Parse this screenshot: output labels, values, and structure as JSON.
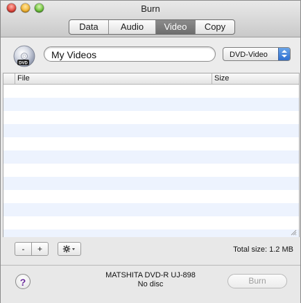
{
  "window": {
    "title": "Burn",
    "tabs": [
      {
        "label": "Data",
        "active": false
      },
      {
        "label": "Audio",
        "active": false
      },
      {
        "label": "Video",
        "active": true
      },
      {
        "label": "Copy",
        "active": false
      }
    ]
  },
  "toolbar": {
    "disc_icon": "dvd-disc-icon",
    "disc_icon_label": "DVD",
    "name_value": "My Videos",
    "format_selected": "DVD-Video"
  },
  "table": {
    "columns": [
      "File",
      "Size"
    ],
    "rows": []
  },
  "bottom_bar": {
    "minus_label": "-",
    "plus_label": "+",
    "action_icon": "gear-icon",
    "total_size": "Total size: 1.2 MB"
  },
  "footer": {
    "help_label": "?",
    "drive_name": "MATSHITA DVD-R UJ-898",
    "drive_status": "No disc",
    "burn_label": "Burn"
  },
  "colors": {
    "accent": "#2e6fd0",
    "row_alt": "#edf3fe",
    "help_glyph": "#6a2a9c"
  }
}
